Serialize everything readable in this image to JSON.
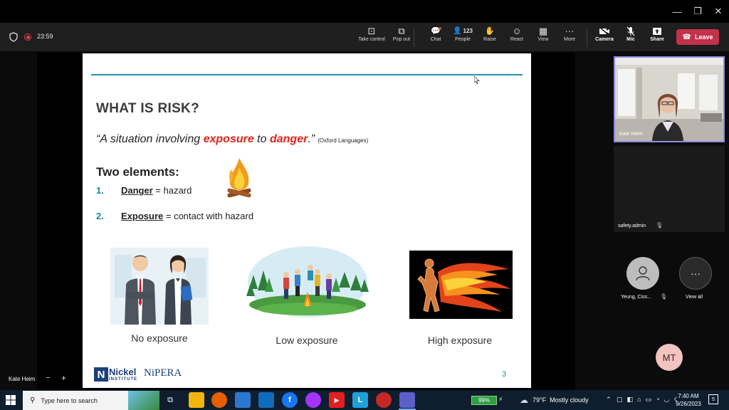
{
  "window": {
    "minimize_icon": "—",
    "restore_icon": "❐",
    "close_icon": "✕"
  },
  "meeting": {
    "timer": "23:59",
    "toolbar": [
      {
        "label": "Take control",
        "icon": "⊡"
      },
      {
        "label": "Pop out",
        "icon": "⧉"
      },
      {
        "label": "Chat",
        "icon": "💬"
      },
      {
        "label": "People",
        "icon": "👤",
        "count": "123"
      },
      {
        "label": "Raise",
        "icon": "✋"
      },
      {
        "label": "React",
        "icon": "☺"
      },
      {
        "label": "View",
        "icon": "▦"
      },
      {
        "label": "More",
        "icon": "···"
      }
    ],
    "controls": [
      {
        "label": "Camera",
        "icon": "■"
      },
      {
        "label": "Mic",
        "icon": "🎤"
      },
      {
        "label": "Share",
        "icon": "⬆"
      }
    ],
    "leave_label": "Leave"
  },
  "slide": {
    "title": "WHAT IS RISK?",
    "quote_pre": "“A situation involving ",
    "quote_word1": "exposure",
    "quote_mid": " to ",
    "quote_word2": "danger",
    "quote_post": ".”",
    "quote_source": "(Oxford Languages)",
    "subtitle": "Two elements:",
    "items": [
      {
        "num": "1.",
        "term": "Danger",
        "rest": " = hazard"
      },
      {
        "num": "2.",
        "term": "Exposure",
        "rest": " = contact with hazard"
      }
    ],
    "captions": [
      "No exposure",
      "Low  exposure",
      "High exposure"
    ],
    "logo1_top": "Nickel",
    "logo1_sub": "INSTITUTE",
    "logo2": "NiPERA",
    "page_number": "3"
  },
  "participants": {
    "presenter_name": "Kate Heim",
    "tile2_name": "safety.admin",
    "person3_name": "Yeung, Ciss...",
    "view_all_label": "View all",
    "mt_initials": "MT",
    "stage_name": "Kate Heim"
  },
  "taskbar": {
    "search_placeholder": "Type here to search",
    "battery": "99%",
    "weather": "79°F  Mostly cloudy",
    "time": "7:40 AM",
    "date": "9/26/2023",
    "notifications": "5"
  },
  "colors": {
    "leave": "#c4314b",
    "accent_rule": "#2f8fb1",
    "danger_red": "#e2231a",
    "teal": "#1a8a8a",
    "speaker_border": "#8f8ae0"
  }
}
